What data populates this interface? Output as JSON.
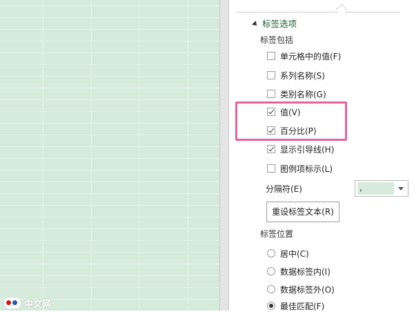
{
  "watermark": {
    "text": "中文网"
  },
  "pane": {
    "section_title": "标签选项",
    "label_contains": {
      "heading": "标签包括",
      "options": [
        {
          "label": "单元格中的值(F)",
          "checked": false
        },
        {
          "label": "系列名称(S)",
          "checked": false
        },
        {
          "label": "类别名称(G)",
          "checked": false
        },
        {
          "label": "值(V)",
          "checked": true
        },
        {
          "label": "百分比(P)",
          "checked": true
        },
        {
          "label": "显示引导线(H)",
          "checked": true
        },
        {
          "label": "图例项标示(L)",
          "checked": false
        }
      ]
    },
    "separator": {
      "label": "分隔符(E)",
      "value": ","
    },
    "reset_button": "重设标签文本(R)",
    "label_position": {
      "heading": "标签位置",
      "options": [
        {
          "label": "居中(C)",
          "selected": false
        },
        {
          "label": "数据标签内(I)",
          "selected": false
        },
        {
          "label": "数据标签外(O)",
          "selected": false
        },
        {
          "label": "最佳匹配(F)",
          "selected": true
        }
      ]
    },
    "highlight_color": "#e8609a",
    "accent_color": "#1f5e39"
  }
}
